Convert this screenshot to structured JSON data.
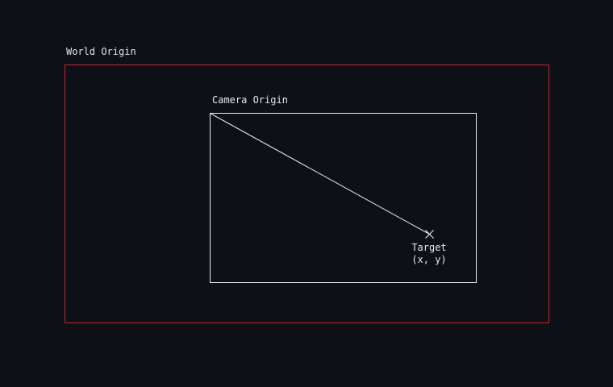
{
  "world_label": "World Origin",
  "camera_label": "Camera Origin",
  "target": {
    "name": "Target",
    "coords": "(x, y)"
  },
  "colors": {
    "background": "#0d1117",
    "world_frame": "#c0262b",
    "camera_frame": "#e8e8e8",
    "text": "#e6e6e6"
  }
}
